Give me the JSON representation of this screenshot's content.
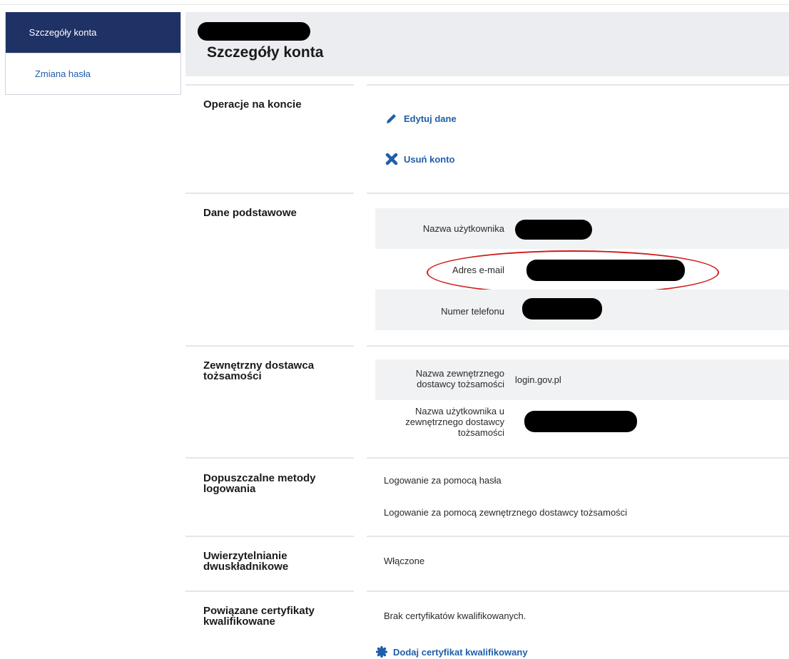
{
  "sidebar": {
    "items": [
      {
        "label": "Szczegóły konta",
        "active": true
      },
      {
        "label": "Zmiana hasła",
        "active": false
      }
    ]
  },
  "header": {
    "title": "Szczegóły konta"
  },
  "sections": {
    "operations": {
      "title": "Operacje na koncie",
      "edit_label": "Edytuj dane",
      "delete_label": "Usuń konto"
    },
    "basic": {
      "title": "Dane podstawowe",
      "username_label": "Nazwa użytkownika",
      "email_label": "Adres e-mail",
      "phone_label": "Numer telefonu"
    },
    "idp": {
      "title": "Zewnętrzny dostawca tożsamości",
      "provider_label": "Nazwa zewnętrznego dostawcy tożsamości",
      "provider_value": "login.gov.pl",
      "ext_user_label": "Nazwa użytkownika u zewnętrznego dostawcy tożsamości"
    },
    "login_methods": {
      "title": "Dopuszczalne metody logowania",
      "items": [
        "Logowanie za pomocą hasła",
        "Logowanie za pomocą zewnętrznego dostawcy tożsamości"
      ]
    },
    "twofa": {
      "title": "Uwierzytelnianie dwuskładnikowe",
      "value": "Włączone"
    },
    "certs": {
      "title": "Powiązane certyfikaty kwalifikowane",
      "value": "Brak certyfikatów kwalifikowanych.",
      "add_label": "Dodaj certyfikat kwalifikowany"
    }
  },
  "colors": {
    "sidebar_active_bg": "#1f3266",
    "link": "#1f5ea8",
    "annotation": "#d11a1a"
  }
}
